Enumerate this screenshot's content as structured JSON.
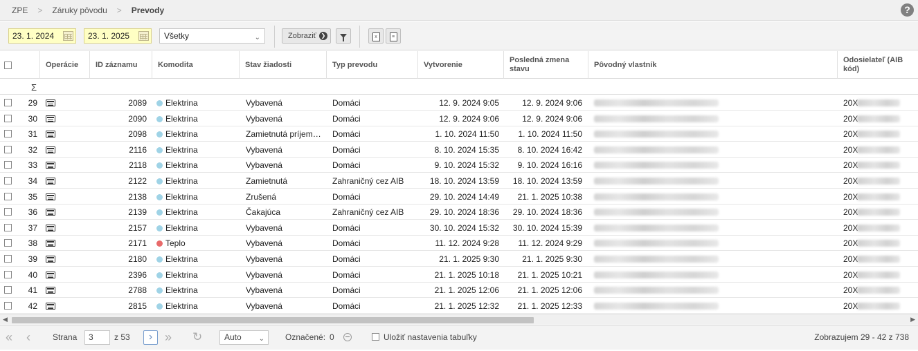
{
  "breadcrumb": {
    "items": [
      "ZPE",
      "Záruky pôvodu"
    ],
    "current": "Prevody"
  },
  "help_label": "?",
  "filters": {
    "date_from": "23. 1. 2024",
    "date_to": "23. 1. 2025",
    "status_select": "Všetky",
    "show_button": "Zobraziť"
  },
  "columns": {
    "operations": "Operácie",
    "record_id": "ID záznamu",
    "commodity": "Komodita",
    "request_status": "Stav žiadosti",
    "transfer_type": "Typ prevodu",
    "created": "Vytvorenie",
    "last_change": "Posledná zmena stavu",
    "original_owner": "Pôvodný vlastník",
    "sender": "Odosielateľ (AIB kód)"
  },
  "sum_symbol": "Σ",
  "colors": {
    "elektrina": "#9fd3e6",
    "teplo": "#e86a6a"
  },
  "rows": [
    {
      "n": "29",
      "id": "2089",
      "kom": "Elektrina",
      "stav": "Vybavená",
      "typ": "Domáci",
      "vyt": "12. 9. 2024 9:05",
      "pos": "12. 9. 2024 9:06",
      "ods": "20X"
    },
    {
      "n": "30",
      "id": "2090",
      "kom": "Elektrina",
      "stav": "Vybavená",
      "typ": "Domáci",
      "vyt": "12. 9. 2024 9:06",
      "pos": "12. 9. 2024 9:06",
      "ods": "20X"
    },
    {
      "n": "31",
      "id": "2098",
      "kom": "Elektrina",
      "stav": "Zamietnutá príjem…",
      "typ": "Domáci",
      "vyt": "1. 10. 2024 11:50",
      "pos": "1. 10. 2024 11:50",
      "ods": "20X"
    },
    {
      "n": "32",
      "id": "2116",
      "kom": "Elektrina",
      "stav": "Vybavená",
      "typ": "Domáci",
      "vyt": "8. 10. 2024 15:35",
      "pos": "8. 10. 2024 16:42",
      "ods": "20X"
    },
    {
      "n": "33",
      "id": "2118",
      "kom": "Elektrina",
      "stav": "Vybavená",
      "typ": "Domáci",
      "vyt": "9. 10. 2024 15:32",
      "pos": "9. 10. 2024 16:16",
      "ods": "20X"
    },
    {
      "n": "34",
      "id": "2122",
      "kom": "Elektrina",
      "stav": "Zamietnutá",
      "typ": "Zahraničný cez AIB",
      "vyt": "18. 10. 2024 13:59",
      "pos": "18. 10. 2024 13:59",
      "ods": "20X"
    },
    {
      "n": "35",
      "id": "2138",
      "kom": "Elektrina",
      "stav": "Zrušená",
      "typ": "Domáci",
      "vyt": "29. 10. 2024 14:49",
      "pos": "21. 1. 2025 10:38",
      "ods": "20X"
    },
    {
      "n": "36",
      "id": "2139",
      "kom": "Elektrina",
      "stav": "Čakajúca",
      "typ": "Zahraničný cez AIB",
      "vyt": "29. 10. 2024 18:36",
      "pos": "29. 10. 2024 18:36",
      "ods": "20X"
    },
    {
      "n": "37",
      "id": "2157",
      "kom": "Elektrina",
      "stav": "Vybavená",
      "typ": "Domáci",
      "vyt": "30. 10. 2024 15:32",
      "pos": "30. 10. 2024 15:39",
      "ods": "20X"
    },
    {
      "n": "38",
      "id": "2171",
      "kom": "Teplo",
      "stav": "Vybavená",
      "typ": "Domáci",
      "vyt": "11. 12. 2024 9:28",
      "pos": "11. 12. 2024 9:29",
      "ods": "20X"
    },
    {
      "n": "39",
      "id": "2180",
      "kom": "Elektrina",
      "stav": "Vybavená",
      "typ": "Domáci",
      "vyt": "21. 1. 2025 9:30",
      "pos": "21. 1. 2025 9:30",
      "ods": "20X"
    },
    {
      "n": "40",
      "id": "2396",
      "kom": "Elektrina",
      "stav": "Vybavená",
      "typ": "Domáci",
      "vyt": "21. 1. 2025 10:18",
      "pos": "21. 1. 2025 10:21",
      "ods": "20X"
    },
    {
      "n": "41",
      "id": "2788",
      "kom": "Elektrina",
      "stav": "Vybavená",
      "typ": "Domáci",
      "vyt": "21. 1. 2025 12:06",
      "pos": "21. 1. 2025 12:06",
      "ods": "20X"
    },
    {
      "n": "42",
      "id": "2815",
      "kom": "Elektrina",
      "stav": "Vybavená",
      "typ": "Domáci",
      "vyt": "21. 1. 2025 12:32",
      "pos": "21. 1. 2025 12:33",
      "ods": "20X"
    }
  ],
  "pager": {
    "page_label": "Strana",
    "page_value": "3",
    "of_label": "z 53",
    "size_select": "Auto",
    "selected_label": "Označené:",
    "selected_count": "0",
    "save_settings": "Uložiť nastavenia tabuľky",
    "summary": "Zobrazujem 29 - 42 z 738"
  }
}
